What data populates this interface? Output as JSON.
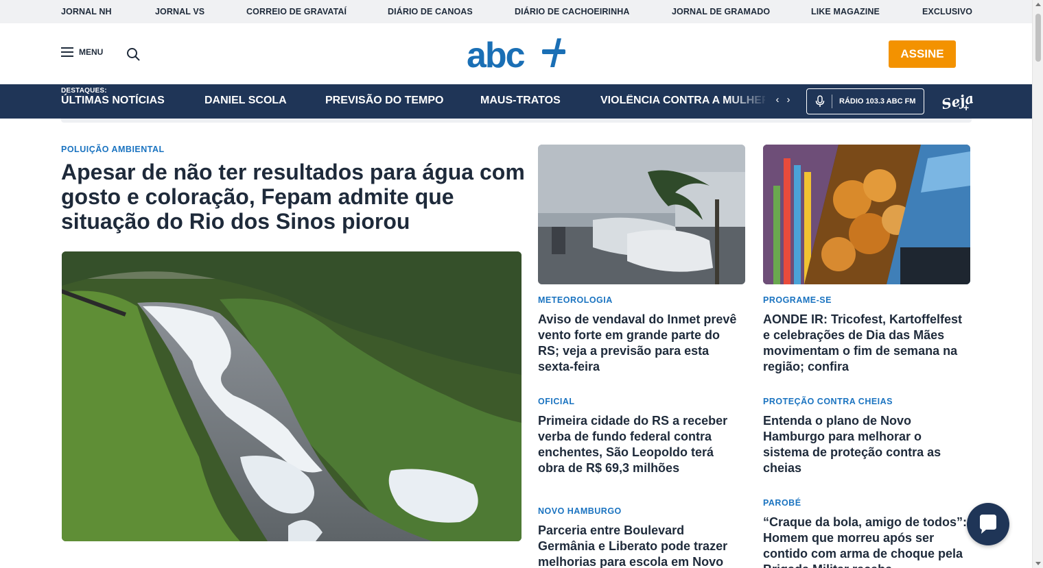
{
  "network_links": [
    "JORNAL NH",
    "JORNAL VS",
    "CORREIO DE GRAVATAÍ",
    "DIÁRIO DE CANOAS",
    "DIÁRIO DE CACHOEIRINHA",
    "JORNAL DE GRAMADO",
    "LIKE MAGAZINE",
    "EXCLUSIVO"
  ],
  "header": {
    "menu_label": "MENU",
    "logo_text": "abc+",
    "subscribe_label": "ASSINE"
  },
  "nav": {
    "kicker": "DESTAQUES:",
    "items": [
      "ÚLTIMAS NOTÍCIAS",
      "DANIEL SCOLA",
      "PREVISÃO DO TEMPO",
      "MAUS-TRATOS",
      "VIOLÊNCIA CONTRA A MULHER"
    ],
    "prev_arrow": "‹",
    "next_arrow": "›",
    "radio_label": "RÁDIO 103.3 ABC FM",
    "seja_logo_text": "Seja+"
  },
  "lead": {
    "kicker": "POLUIÇÃO AMBIENTAL",
    "title": "Apesar de não ter resultados para água com gosto e coloração, Fepam admite que situação do Rio dos Sinos piorou",
    "image": "river-foam-photo"
  },
  "cards": [
    {
      "kicker": "METEOROLOGIA",
      "title": "Aviso de vendaval do Inmet prevê vento forte em grande parte do RS; veja a previsão para esta sexta-feira",
      "image": "windy-street-photo"
    },
    {
      "kicker": "PROGRAME-SE",
      "title": "AONDE IR: Tricofest, Kartoffelfest e celebrações de Dia das Mães movimentam o fim de semana na região; confira",
      "image": "festival-collage-photo"
    },
    {
      "kicker": "OFICIAL",
      "title": "Primeira cidade do RS a receber verba de fundo federal contra enchentes, São Leopoldo terá obra de R$ 69,3 milhões"
    },
    {
      "kicker": "PROTEÇÃO CONTRA CHEIAS",
      "title": "Entenda o plano de Novo Hamburgo para melhorar o sistema de proteção contra as cheias"
    },
    {
      "kicker": "NOVO HAMBURGO",
      "title": "Parceria entre Boulevard Germânia e Liberato pode trazer melhorias para escola em Novo"
    },
    {
      "kicker": "PAROBÉ",
      "title": "“Craque da bola, amigo de todos”: Homem que morreu após ser contido com arma de choque pela Brigada Militar recebe"
    }
  ],
  "colors": {
    "brand_blue": "#1a6fb5",
    "nav_bg": "#1f3557",
    "accent_orange": "#f39200",
    "kicker_blue": "#1a73c0"
  }
}
